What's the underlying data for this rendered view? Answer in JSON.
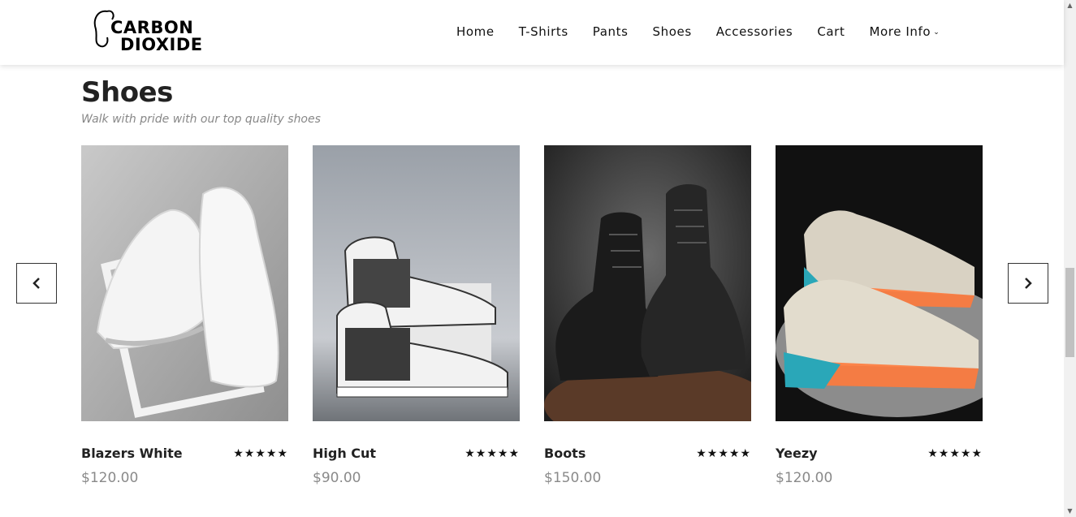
{
  "brand": {
    "line1": "CARBON",
    "line2": "DIOXIDE"
  },
  "nav": {
    "items": [
      "Home",
      "T-Shirts",
      "Pants",
      "Shoes",
      "Accessories",
      "Cart"
    ],
    "more_label": "More Info",
    "more_chevron": "⌄"
  },
  "section": {
    "title": "Shoes",
    "subtitle": "Walk with pride with our top quality shoes"
  },
  "products": [
    {
      "name": "Blazers White",
      "price": "$120.00",
      "rating": 5,
      "stars": "★★★★★"
    },
    {
      "name": "High Cut",
      "price": "$90.00",
      "rating": 5,
      "stars": "★★★★★"
    },
    {
      "name": "Boots",
      "price": "$150.00",
      "rating": 5,
      "stars": "★★★★★"
    },
    {
      "name": "Yeezy",
      "price": "$120.00",
      "rating": 5,
      "stars": "★★★★★"
    }
  ],
  "colors": {
    "text": "#222222",
    "price": "#8a8a8a",
    "accent_orange": "#ff7a3c",
    "accent_teal": "#2aa7b8"
  },
  "icons": {
    "prev": "chevron-left-icon",
    "next": "chevron-right-icon"
  }
}
